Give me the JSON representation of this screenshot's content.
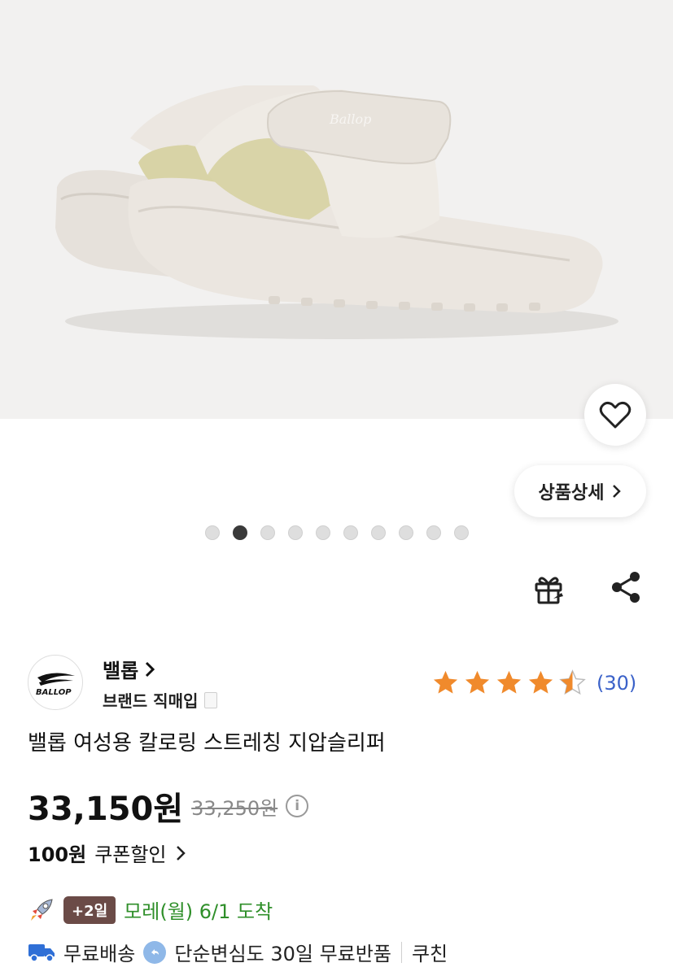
{
  "hero": {
    "image_alt": "sandal-photo",
    "dots_total": 10,
    "active_dot": 2
  },
  "wishlist": {
    "icon": "heart-outline-icon"
  },
  "detail_button": {
    "label": "상품상세"
  },
  "actions": {
    "gift_icon": "gift-icon",
    "share_icon": "share-icon"
  },
  "brand": {
    "name": "밸롭",
    "type": "브랜드 직매입",
    "logo_text": "BALLOP"
  },
  "rating": {
    "stars": 4.5,
    "count": "(30)",
    "star_color": "#f08a2c"
  },
  "product": {
    "title": "밸롭 여성용 칼로링 스트레칭 지압슬리퍼"
  },
  "price": {
    "sale": "33,150원",
    "original": "33,250원"
  },
  "coupon": {
    "amount": "100원",
    "label": "쿠폰할인"
  },
  "delivery": {
    "badge": "+2일",
    "arrival": "모레(월) 6/1 도착",
    "arrival_color": "#2f8f2a"
  },
  "services": {
    "free_shipping": "무료배송",
    "free_return": "단순변심도 30일 무료반품",
    "cushion": "쿠친"
  }
}
